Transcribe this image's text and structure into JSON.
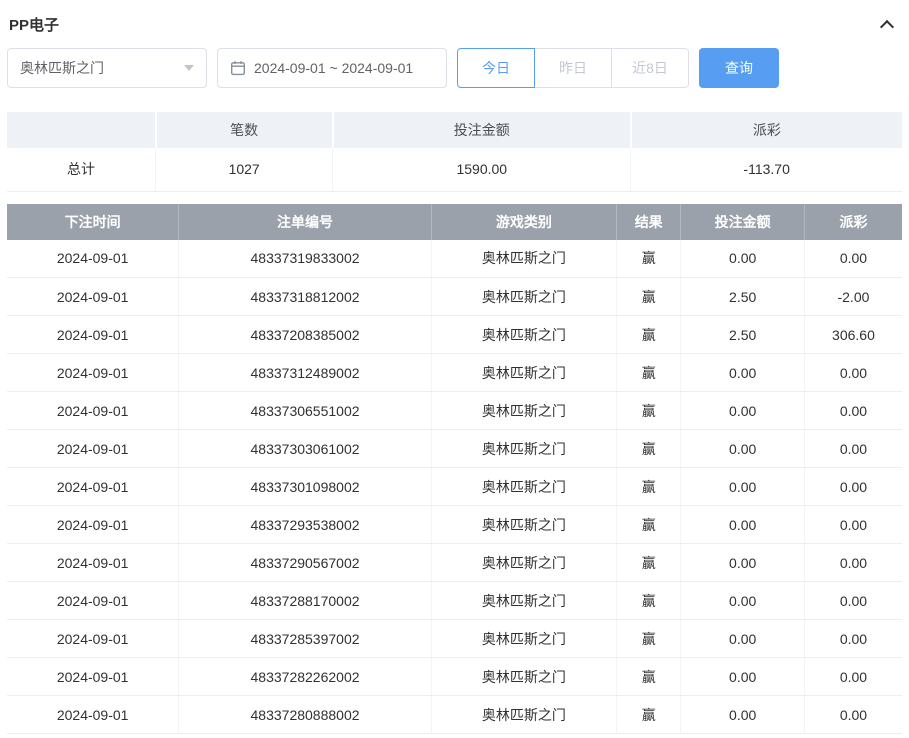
{
  "header": {
    "title": "PP电子"
  },
  "filters": {
    "game_select": {
      "value": "奥林匹斯之门"
    },
    "date_range": {
      "value": "2024-09-01 ~ 2024-09-01"
    },
    "quick_buttons": [
      {
        "label": "今日",
        "active": true
      },
      {
        "label": "昨日",
        "active": false
      },
      {
        "label": "近8日",
        "active": false
      }
    ],
    "search_label": "查询"
  },
  "summary": {
    "headers": [
      "",
      "笔数",
      "投注金额",
      "派彩"
    ],
    "row_label": "总计",
    "count": "1027",
    "bet_amount": "1590.00",
    "payout": "-113.70"
  },
  "table": {
    "columns": [
      "下注时间",
      "注单编号",
      "游戏类别",
      "结果",
      "投注金额",
      "派彩"
    ],
    "rows": [
      {
        "date": "2024-09-01",
        "bet_id": "48337319833002",
        "game": "奥林匹斯之门",
        "result": "赢",
        "amount": "0.00",
        "payout": "0.00"
      },
      {
        "date": "2024-09-01",
        "bet_id": "48337318812002",
        "game": "奥林匹斯之门",
        "result": "赢",
        "amount": "2.50",
        "payout": "-2.00"
      },
      {
        "date": "2024-09-01",
        "bet_id": "48337208385002",
        "game": "奥林匹斯之门",
        "result": "赢",
        "amount": "2.50",
        "payout": "306.60"
      },
      {
        "date": "2024-09-01",
        "bet_id": "48337312489002",
        "game": "奥林匹斯之门",
        "result": "赢",
        "amount": "0.00",
        "payout": "0.00"
      },
      {
        "date": "2024-09-01",
        "bet_id": "48337306551002",
        "game": "奥林匹斯之门",
        "result": "赢",
        "amount": "0.00",
        "payout": "0.00"
      },
      {
        "date": "2024-09-01",
        "bet_id": "48337303061002",
        "game": "奥林匹斯之门",
        "result": "赢",
        "amount": "0.00",
        "payout": "0.00"
      },
      {
        "date": "2024-09-01",
        "bet_id": "48337301098002",
        "game": "奥林匹斯之门",
        "result": "赢",
        "amount": "0.00",
        "payout": "0.00"
      },
      {
        "date": "2024-09-01",
        "bet_id": "48337293538002",
        "game": "奥林匹斯之门",
        "result": "赢",
        "amount": "0.00",
        "payout": "0.00"
      },
      {
        "date": "2024-09-01",
        "bet_id": "48337290567002",
        "game": "奥林匹斯之门",
        "result": "赢",
        "amount": "0.00",
        "payout": "0.00"
      },
      {
        "date": "2024-09-01",
        "bet_id": "48337288170002",
        "game": "奥林匹斯之门",
        "result": "赢",
        "amount": "0.00",
        "payout": "0.00"
      },
      {
        "date": "2024-09-01",
        "bet_id": "48337285397002",
        "game": "奥林匹斯之门",
        "result": "赢",
        "amount": "0.00",
        "payout": "0.00"
      },
      {
        "date": "2024-09-01",
        "bet_id": "48337282262002",
        "game": "奥林匹斯之门",
        "result": "赢",
        "amount": "0.00",
        "payout": "0.00"
      },
      {
        "date": "2024-09-01",
        "bet_id": "48337280888002",
        "game": "奥林匹斯之门",
        "result": "赢",
        "amount": "0.00",
        "payout": "0.00"
      }
    ]
  },
  "colors": {
    "accent_blue": "#579ef2",
    "negative_red": "#f56c6c",
    "table_header_bg": "#9ba1ab",
    "summary_header_bg": "#eef1f6"
  }
}
